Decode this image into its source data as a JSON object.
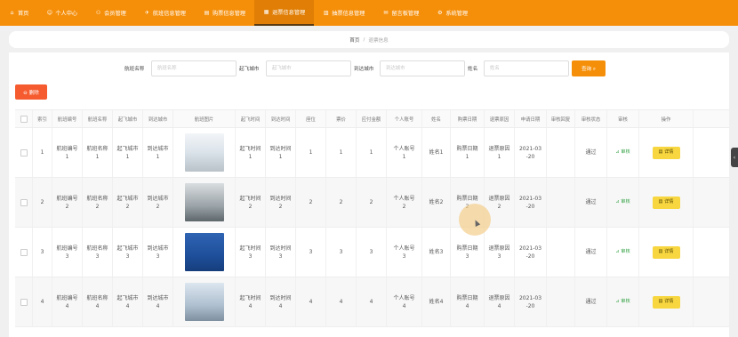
{
  "nav": [
    {
      "label": "首页",
      "icon": "home-icon",
      "glyph": "⌂"
    },
    {
      "label": "个人中心",
      "icon": "user-icon",
      "glyph": "☺"
    },
    {
      "label": "会员管理",
      "icon": "users-icon",
      "glyph": "⚇"
    },
    {
      "label": "航班信息管理",
      "icon": "plane-icon",
      "glyph": "✈"
    },
    {
      "label": "购票信息管理",
      "icon": "ticket-icon",
      "glyph": "▤"
    },
    {
      "label": "退票信息管理",
      "icon": "refund-icon",
      "glyph": "▦"
    },
    {
      "label": "抽票信息管理",
      "icon": "list-icon",
      "glyph": "▥"
    },
    {
      "label": "留言板管理",
      "icon": "message-icon",
      "glyph": "✉"
    },
    {
      "label": "系统管理",
      "icon": "settings-icon",
      "glyph": "⚙"
    }
  ],
  "active_nav": 5,
  "breadcrumb": {
    "home": "首页",
    "sep": "/",
    "current": "退票信息"
  },
  "search": {
    "flight_name_label": "航班名称",
    "flight_name_placeholder": "航班名称",
    "depart_label": "起飞城市",
    "depart_placeholder": "起飞城市",
    "arrive_label": "到达城市",
    "arrive_placeholder": "到达城市",
    "name_label": "姓名",
    "name_placeholder": "姓名",
    "button": "查询 ⌕"
  },
  "delete_button": "⊖ 删除",
  "columns": [
    "",
    "索引",
    "航班编号",
    "航班名称",
    "起飞城市",
    "到达城市",
    "航班图片",
    "起飞时间",
    "到达时间",
    "座位",
    "票价",
    "应付金额",
    "个人账号",
    "姓名",
    "购票日期",
    "退票原因",
    "申请日期",
    "审核回复",
    "审核状态",
    "审核",
    "操作"
  ],
  "rows": [
    {
      "index": "1",
      "no": "航班编号\n1",
      "name": "航班名称\n1",
      "from": "起飞城市\n1",
      "to": "到达城市\n1",
      "dep": "起飞时间\n1",
      "arr": "到达时间\n1",
      "seat": "1",
      "price": "1",
      "pay": "1",
      "account": "个人账号\n1",
      "user": "姓名1",
      "buy": "购票日期\n1",
      "reason": "退票原因\n1",
      "apply": "2021-03\n-20",
      "reply": "",
      "status": "通过",
      "audit": "⊿ 审核",
      "detail": "▤ 详情",
      "img": "p1"
    },
    {
      "index": "2",
      "no": "航班编号\n2",
      "name": "航班名称\n2",
      "from": "起飞城市\n2",
      "to": "到达城市\n2",
      "dep": "起飞时间\n2",
      "arr": "到达时间\n2",
      "seat": "2",
      "price": "2",
      "pay": "2",
      "account": "个人账号\n2",
      "user": "姓名2",
      "buy": "购票日期\n2",
      "reason": "退票原因\n2",
      "apply": "2021-03\n-20",
      "reply": "",
      "status": "通过",
      "audit": "⊿ 审核",
      "detail": "▤ 详情",
      "img": "p2"
    },
    {
      "index": "3",
      "no": "航班编号\n3",
      "name": "航班名称\n3",
      "from": "起飞城市\n3",
      "to": "到达城市\n3",
      "dep": "起飞时间\n3",
      "arr": "到达时间\n3",
      "seat": "3",
      "price": "3",
      "pay": "3",
      "account": "个人账号\n3",
      "user": "姓名3",
      "buy": "购票日期\n3",
      "reason": "退票原因\n3",
      "apply": "2021-03\n-20",
      "reply": "",
      "status": "通过",
      "audit": "⊿ 审核",
      "detail": "▤ 详情",
      "img": "p3"
    },
    {
      "index": "4",
      "no": "航班编号\n4",
      "name": "航班名称\n4",
      "from": "起飞城市\n4",
      "to": "到达城市\n4",
      "dep": "起飞时间\n4",
      "arr": "到达时间\n4",
      "seat": "4",
      "price": "4",
      "pay": "4",
      "account": "个人账号\n4",
      "user": "姓名4",
      "buy": "购票日期\n4",
      "reason": "退票原因\n4",
      "apply": "2021-03\n-20",
      "reply": "",
      "status": "通过",
      "audit": "⊿ 审核",
      "detail": "▤ 详情",
      "img": "p4"
    }
  ],
  "side_tab": "‹",
  "colors": {
    "nav": "#f58f0a",
    "delete": "#f55b2e",
    "detail": "#f7d640",
    "audit": "#3aa44a"
  }
}
